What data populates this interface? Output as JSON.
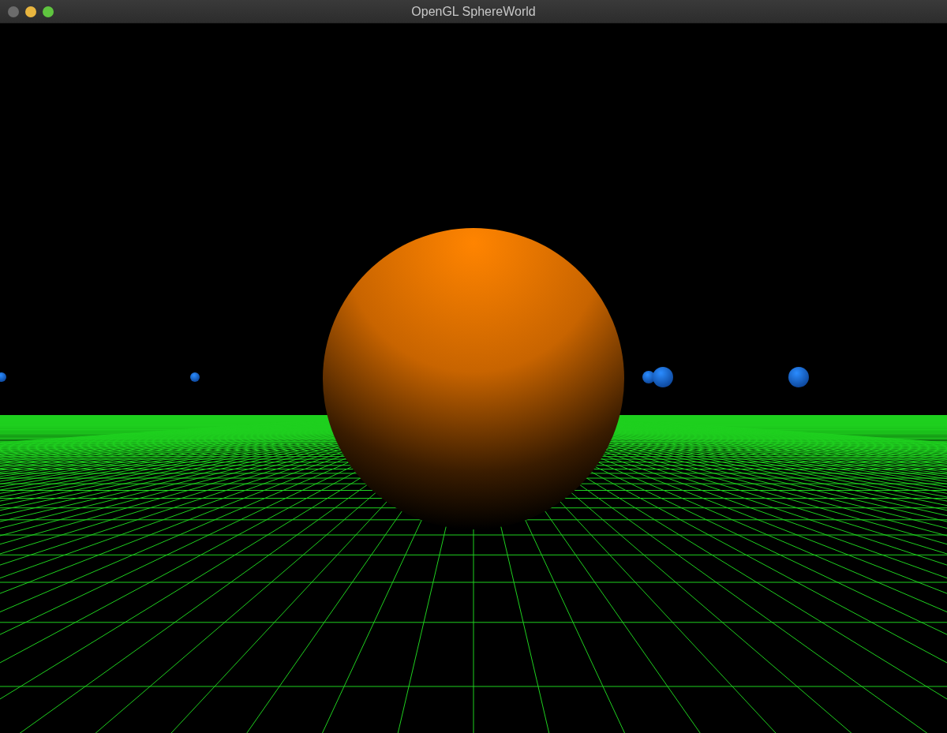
{
  "window": {
    "title": "OpenGL SphereWorld"
  },
  "window_controls": [
    {
      "kind": "close",
      "disabled": true
    },
    {
      "kind": "minimize",
      "disabled": false
    },
    {
      "kind": "zoom",
      "disabled": false
    }
  ]
}
